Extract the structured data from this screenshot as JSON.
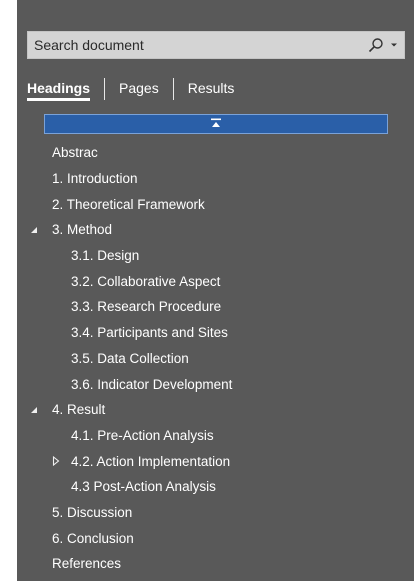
{
  "search": {
    "placeholder": "Search document",
    "icon": "search-icon",
    "dropdown_icon": "caret-down-icon"
  },
  "tabs": [
    {
      "label": "Headings",
      "active": true
    },
    {
      "label": "Pages",
      "active": false
    },
    {
      "label": "Results",
      "active": false
    }
  ],
  "collapse_bar": {
    "icon": "collapse-up-icon",
    "color": "#2a5fa8"
  },
  "headings": [
    {
      "label": "Abstrac",
      "level": 0,
      "toggle": null
    },
    {
      "label": "1. Introduction",
      "level": 0,
      "toggle": null
    },
    {
      "label": "2. Theoretical Framework",
      "level": 0,
      "toggle": null
    },
    {
      "label": "3. Method",
      "level": 0,
      "toggle": "expanded"
    },
    {
      "label": "3.1. Design",
      "level": 1,
      "toggle": null
    },
    {
      "label": "3.2. Collaborative Aspect",
      "level": 1,
      "toggle": null
    },
    {
      "label": "3.3. Research Procedure",
      "level": 1,
      "toggle": null
    },
    {
      "label": "3.4. Participants and Sites",
      "level": 1,
      "toggle": null
    },
    {
      "label": "3.5. Data Collection",
      "level": 1,
      "toggle": null
    },
    {
      "label": "3.6. Indicator Development",
      "level": 1,
      "toggle": null
    },
    {
      "label": "4. Result",
      "level": 0,
      "toggle": "expanded"
    },
    {
      "label": "4.1. Pre-Action Analysis",
      "level": 1,
      "toggle": null
    },
    {
      "label": "4.2. Action Implementation",
      "level": 1,
      "toggle": "collapsed"
    },
    {
      "label": "4.3 Post-Action Analysis",
      "level": 1,
      "toggle": null
    },
    {
      "label": "5. Discussion",
      "level": 0,
      "toggle": null
    },
    {
      "label": "6. Conclusion",
      "level": 0,
      "toggle": null
    },
    {
      "label": "References",
      "level": 0,
      "toggle": null
    }
  ],
  "colors": {
    "pane_background": "#595959",
    "search_background": "#d4d4d4",
    "accent": "#2a5fa8"
  }
}
